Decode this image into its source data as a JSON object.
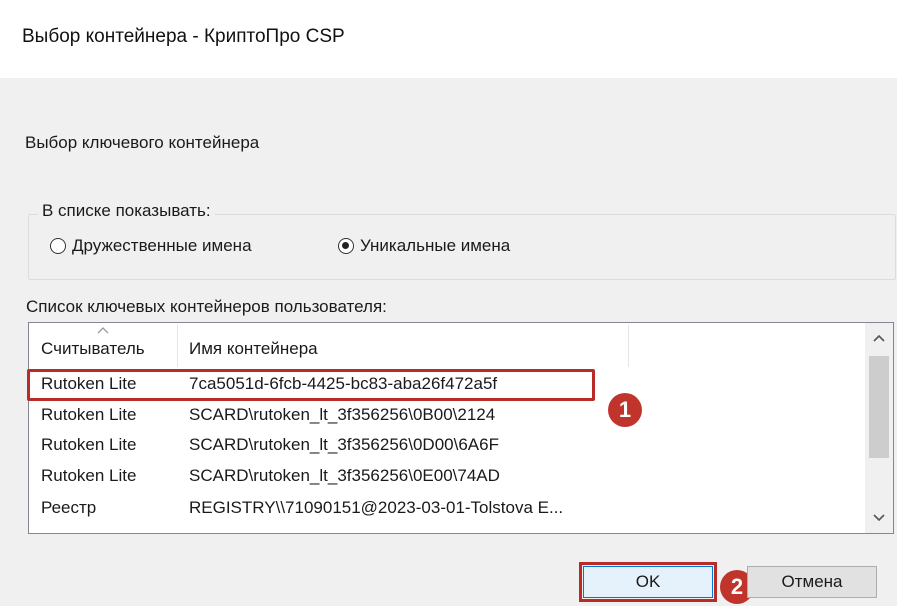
{
  "window": {
    "title": "Выбор контейнера - КриптоПро CSP"
  },
  "heading": "Выбор ключевого контейнера",
  "show_group": {
    "legend": "В списке показывать:",
    "options": [
      {
        "label": "Дружественные имена",
        "selected": false
      },
      {
        "label": "Уникальные имена",
        "selected": true
      }
    ]
  },
  "list": {
    "caption": "Список ключевых контейнеров пользователя:",
    "columns": [
      "Считыватель",
      "Имя контейнера"
    ],
    "rows": [
      {
        "reader": "Rutoken Lite",
        "name": "7ca5051d-6fcb-4425-bc83-aba26f472a5f"
      },
      {
        "reader": "Rutoken Lite",
        "name": "SCARD\\rutoken_lt_3f356256\\0B00\\2124"
      },
      {
        "reader": "Rutoken Lite",
        "name": "SCARD\\rutoken_lt_3f356256\\0D00\\6A6F"
      },
      {
        "reader": "Rutoken Lite",
        "name": "SCARD\\rutoken_lt_3f356256\\0E00\\74AD"
      },
      {
        "reader": "Реестр",
        "name": "REGISTRY\\\\71090151@2023-03-01-Tolstova E..."
      }
    ]
  },
  "annotations": {
    "step1": "1",
    "step2": "2",
    "marker_color": "#b92b27"
  },
  "buttons": {
    "ok": "OK",
    "cancel": "Отмена"
  }
}
